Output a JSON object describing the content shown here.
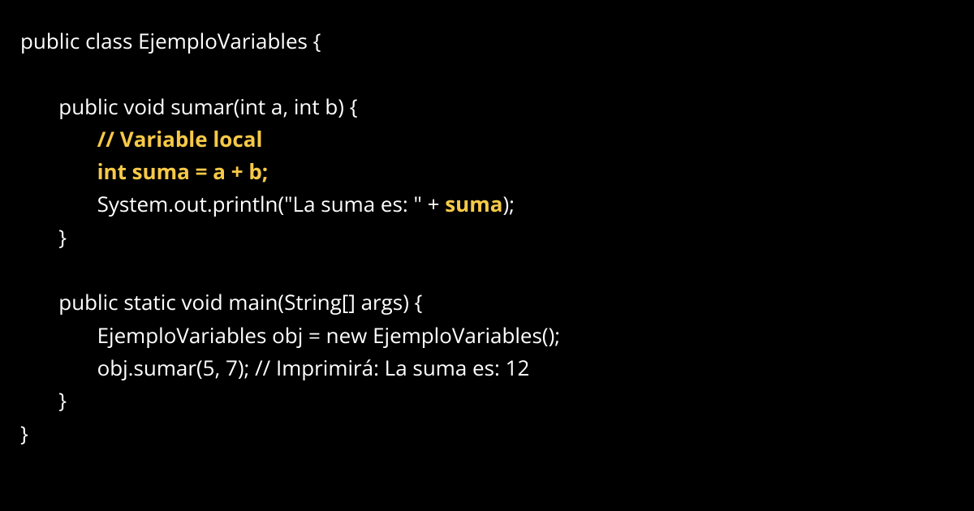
{
  "code": {
    "lines": [
      {
        "indent": 0,
        "segments": [
          {
            "text": "public class EjemploVariables {",
            "style": "normal"
          }
        ]
      },
      {
        "indent": 0,
        "segments": [
          {
            "text": "",
            "style": "normal"
          }
        ]
      },
      {
        "indent": 1,
        "segments": [
          {
            "text": "public void sumar(int a, int b) {",
            "style": "normal"
          }
        ]
      },
      {
        "indent": 2,
        "segments": [
          {
            "text": "// Variable local",
            "style": "hl"
          }
        ]
      },
      {
        "indent": 2,
        "segments": [
          {
            "text": "int suma = a + b;",
            "style": "hl"
          }
        ]
      },
      {
        "indent": 2,
        "segments": [
          {
            "text": "System.out.println(\"La suma es: \" + ",
            "style": "normal"
          },
          {
            "text": "suma",
            "style": "hl-inline"
          },
          {
            "text": ");",
            "style": "normal"
          }
        ]
      },
      {
        "indent": 1,
        "segments": [
          {
            "text": "}",
            "style": "normal"
          }
        ]
      },
      {
        "indent": 0,
        "segments": [
          {
            "text": "",
            "style": "normal"
          }
        ]
      },
      {
        "indent": 1,
        "segments": [
          {
            "text": "public static void main(String[] args) {",
            "style": "normal"
          }
        ]
      },
      {
        "indent": 2,
        "segments": [
          {
            "text": "EjemploVariables obj = new EjemploVariables();",
            "style": "normal"
          }
        ]
      },
      {
        "indent": 2,
        "segments": [
          {
            "text": "obj.sumar(5, 7); // Imprimirá: La suma es: 12",
            "style": "normal"
          }
        ]
      },
      {
        "indent": 1,
        "segments": [
          {
            "text": "}",
            "style": "normal"
          }
        ]
      },
      {
        "indent": 0,
        "segments": [
          {
            "text": "}",
            "style": "normal"
          }
        ]
      }
    ],
    "indentUnit": "       "
  },
  "colors": {
    "background": "#000000",
    "text": "#ffffff",
    "highlight": "#f7c948"
  }
}
